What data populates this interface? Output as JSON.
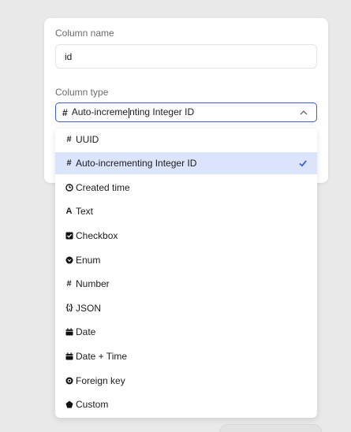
{
  "form": {
    "column_name_label": "Column name",
    "column_name_value": "id",
    "column_type_label": "Column type",
    "column_type_before_caret": "Auto-increme",
    "column_type_after_caret": "nting Integer ID"
  },
  "dropdown": {
    "selected_index": 1,
    "options": [
      {
        "label": "UUID",
        "icon": "hash-icon"
      },
      {
        "label": "Auto-incrementing Integer ID",
        "icon": "hash-icon"
      },
      {
        "label": "Created time",
        "icon": "clock-icon"
      },
      {
        "label": "Text",
        "icon": "text-icon"
      },
      {
        "label": "Checkbox",
        "icon": "checkbox-icon"
      },
      {
        "label": "Enum",
        "icon": "chevron-circle-icon"
      },
      {
        "label": "Number",
        "icon": "hash-icon"
      },
      {
        "label": "JSON",
        "icon": "json-braces-icon"
      },
      {
        "label": "Date",
        "icon": "calendar-icon"
      },
      {
        "label": "Date + Time",
        "icon": "calendar-icon"
      },
      {
        "label": "Foreign key",
        "icon": "link-circle-icon"
      },
      {
        "label": "Custom",
        "icon": "pentagon-icon"
      }
    ]
  },
  "colors": {
    "accent": "#3b5fd6",
    "selected_bg": "#dbe4fb",
    "backdrop": "#e9e9e9"
  }
}
